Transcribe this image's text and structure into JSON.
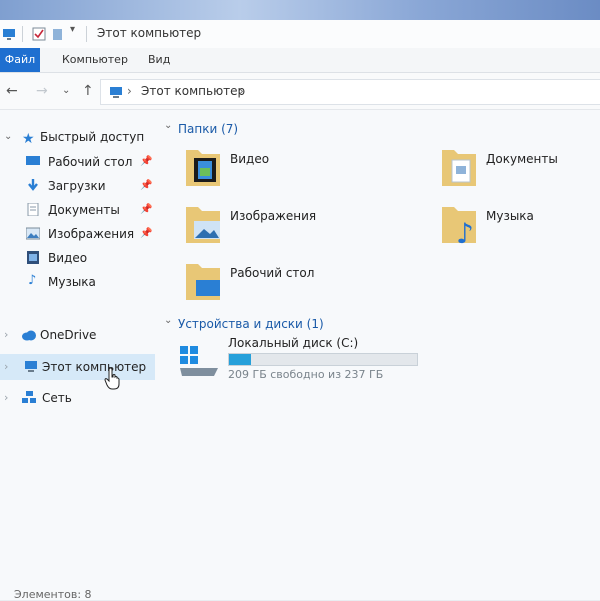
{
  "window": {
    "title": "Этот компьютер"
  },
  "ribbon": {
    "tabs": [
      "Файл",
      "Компьютер",
      "Вид"
    ]
  },
  "address": {
    "crumb": "Этот компьютер"
  },
  "nav": {
    "quick_access": "Быстрый доступ",
    "items": [
      {
        "label": "Рабочий стол",
        "pinned": true
      },
      {
        "label": "Загрузки",
        "pinned": true
      },
      {
        "label": "Документы",
        "pinned": true
      },
      {
        "label": "Изображения",
        "pinned": true
      },
      {
        "label": "Видео",
        "pinned": false
      },
      {
        "label": "Музыка",
        "pinned": false
      }
    ],
    "onedrive": "OneDrive",
    "this_pc": "Этот компьютер",
    "network": "Сеть"
  },
  "content": {
    "folders_header": "Папки (7)",
    "folders": [
      "Видео",
      "Документы",
      "Изображения",
      "Музыка",
      "Рабочий стол"
    ],
    "devices_header": "Устройства и диски (1)",
    "drive": {
      "name": "Локальный диск (C:)",
      "free_text": "209 ГБ свободно из 237 ГБ",
      "used_fraction": 0.118
    }
  },
  "status": {
    "items": "Элементов: 8"
  },
  "colors": {
    "accent": "#1f6fd0",
    "folder": "#e8c776",
    "selection": "#d6e9f8"
  }
}
